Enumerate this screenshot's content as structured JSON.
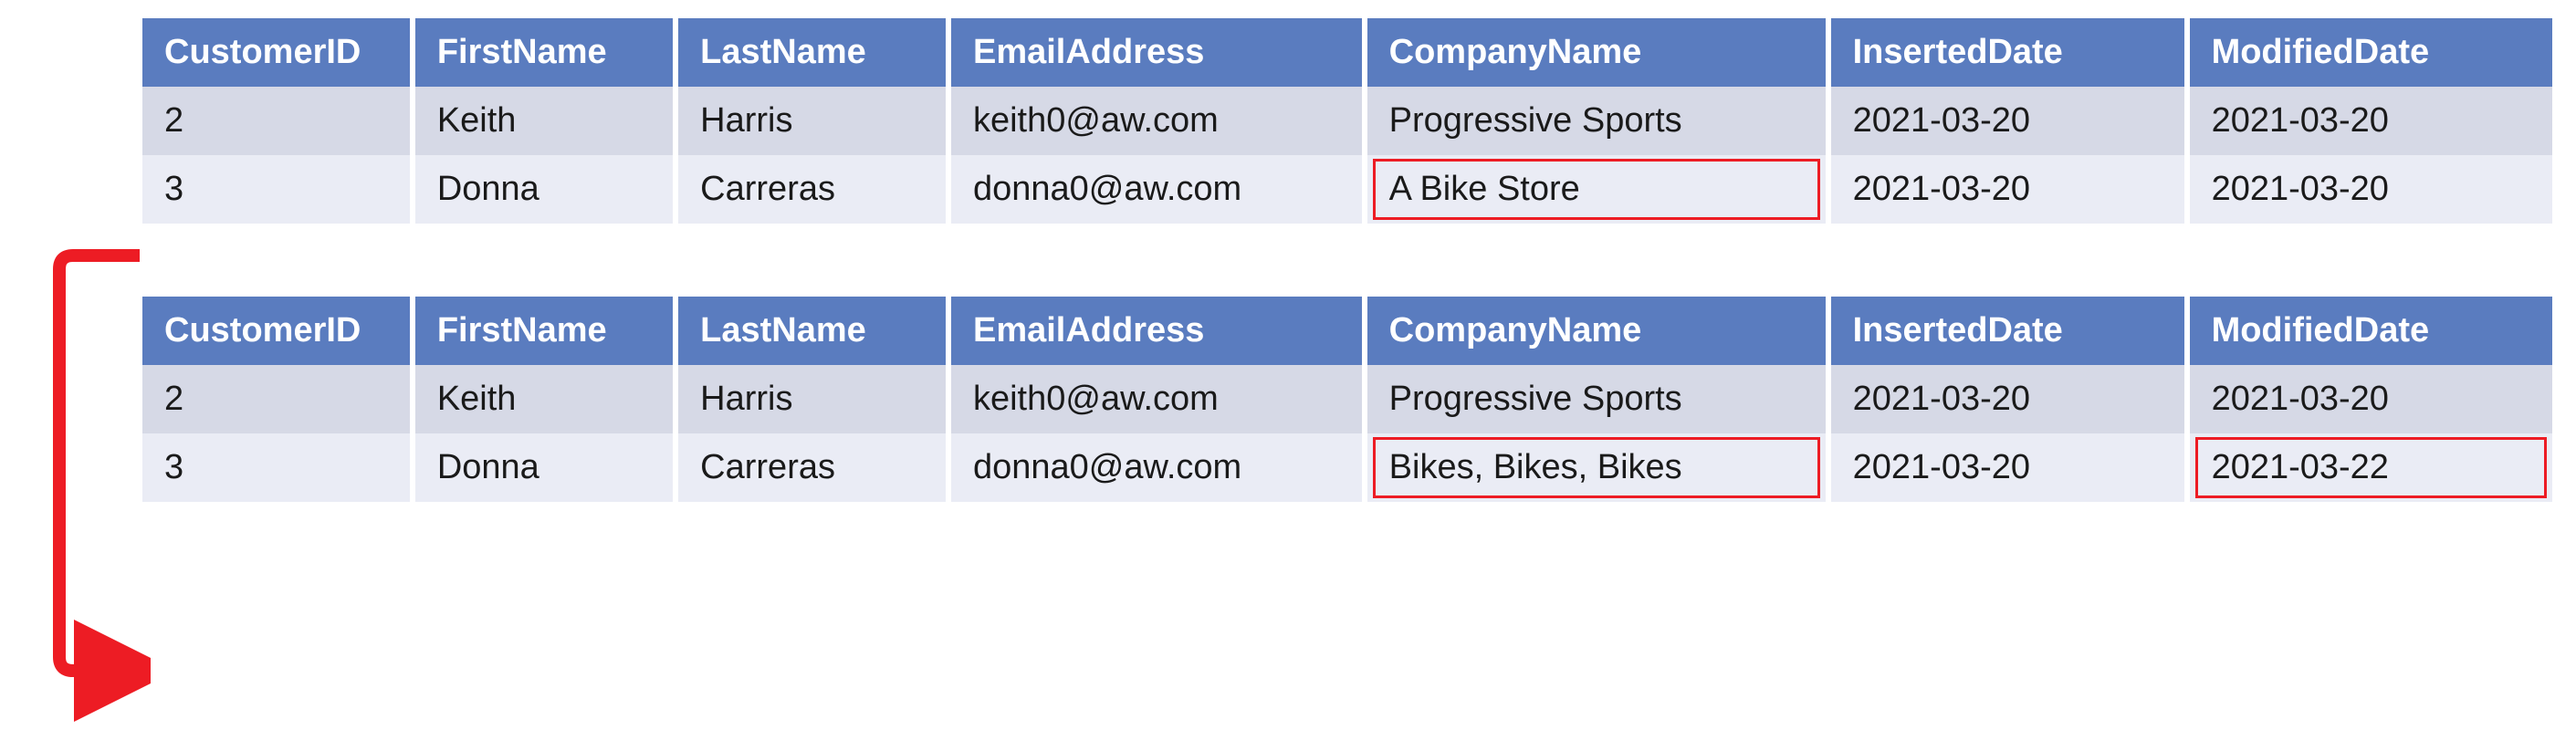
{
  "columns": [
    {
      "key": "CustomerID",
      "label": "CustomerID"
    },
    {
      "key": "FirstName",
      "label": "FirstName"
    },
    {
      "key": "LastName",
      "label": "LastName"
    },
    {
      "key": "EmailAddress",
      "label": "EmailAddress"
    },
    {
      "key": "CompanyName",
      "label": "CompanyName"
    },
    {
      "key": "InsertedDate",
      "label": "InsertedDate"
    },
    {
      "key": "ModifiedDate",
      "label": "ModifiedDate"
    }
  ],
  "tables": {
    "before": {
      "rows": [
        {
          "CustomerID": "2",
          "FirstName": "Keith",
          "LastName": "Harris",
          "EmailAddress": "keith0@aw.com",
          "CompanyName": "Progressive Sports",
          "InsertedDate": "2021-03-20",
          "ModifiedDate": "2021-03-20"
        },
        {
          "CustomerID": "3",
          "FirstName": "Donna",
          "LastName": "Carreras",
          "EmailAddress": "donna0@aw.com",
          "CompanyName": "A Bike Store",
          "InsertedDate": "2021-03-20",
          "ModifiedDate": "2021-03-20"
        }
      ],
      "highlights": [
        {
          "row": 1,
          "col": "CompanyName"
        }
      ]
    },
    "after": {
      "rows": [
        {
          "CustomerID": "2",
          "FirstName": "Keith",
          "LastName": "Harris",
          "EmailAddress": "keith0@aw.com",
          "CompanyName": "Progressive Sports",
          "InsertedDate": "2021-03-20",
          "ModifiedDate": "2021-03-20"
        },
        {
          "CustomerID": "3",
          "FirstName": "Donna",
          "LastName": "Carreras",
          "EmailAddress": "donna0@aw.com",
          "CompanyName": "Bikes, Bikes, Bikes",
          "InsertedDate": "2021-03-20",
          "ModifiedDate": "2021-03-22"
        }
      ],
      "highlights": [
        {
          "row": 1,
          "col": "CompanyName"
        },
        {
          "row": 1,
          "col": "ModifiedDate"
        }
      ]
    }
  },
  "arrow_color": "#ed1c24"
}
